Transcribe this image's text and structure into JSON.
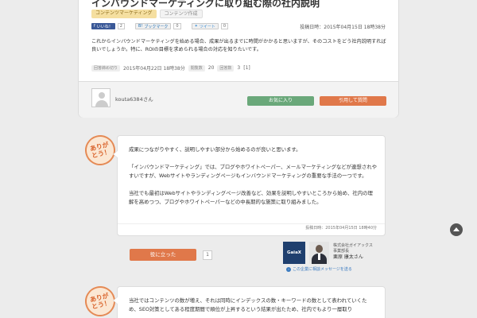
{
  "question": {
    "title": "インバウンドマーケティングに取り組む際の社内説明",
    "tags": [
      "コンテンツマーケティング",
      "コンテンツ作成"
    ],
    "social": {
      "facebook_label": "いいね！",
      "facebook_count": "2",
      "hatena_label": "ブックマーク",
      "hatena_count": "0",
      "twitter_label": "ツイート",
      "twitter_count": "0"
    },
    "posted_date": "投稿日時：2015年04月15日 18時38分",
    "body": "これからインバウンドマーケティングを始める場合、成果が出るまでに時間がかかると思いますが、そのコストをどう社内説明すれば良いでしょうか。特に、ROIの目標を求められる場合の対応を知りたいです。",
    "meta": {
      "answer_label": "回答締め切り",
      "answer_date": "2015年04月22日 18時38分",
      "views_label": "閲覧数",
      "views_value": "20",
      "answers_label": "回答数",
      "answers_value": "3",
      "answers_extra": "[1]"
    },
    "user": {
      "name": "kouta6384",
      "suffix": "さん"
    },
    "fav_button": "お気に入り",
    "quote_button": "引用して質問"
  },
  "badge_text": "ありがとう！",
  "answer1": {
    "paragraphs": [
      "成果につながりやすく、説明しやすい部分から始めるのが良いと思います。",
      "「インバウンドマーケティング」では、ブログやホワイトペーパー、メールマーケティングなどが連想されやすいですが、Webサイトやランディングページもインバウンドマーケティングの重要な手法の一つです。",
      "当社でも最初はWebサイトやランディングページ改善など、効果を説明しやすいところから始め、社内の理解を高めつつ、ブログやホワイトペーパーなどの中長期的な施策に取り組みました。"
    ],
    "date": "投稿日時：2015年04月15日 18時40分",
    "helpful_button": "役に立った",
    "helpful_count": "1",
    "logo_text": "GaiaX",
    "company_name": "株式会社ガイアックス",
    "company_dept": "事業部長",
    "person_name": "栗原 康太",
    "person_suffix": "さん",
    "contact_link": "この企業に相談メッセージを送る"
  },
  "answer2": {
    "text": "当社ではコンテンツの数が増え、それは同時にインデックスの数・キーワードの数として表われていくため、SEO対策としてある程度期間で順位が上昇するという結果が出たため、社内でもより一層取り"
  }
}
